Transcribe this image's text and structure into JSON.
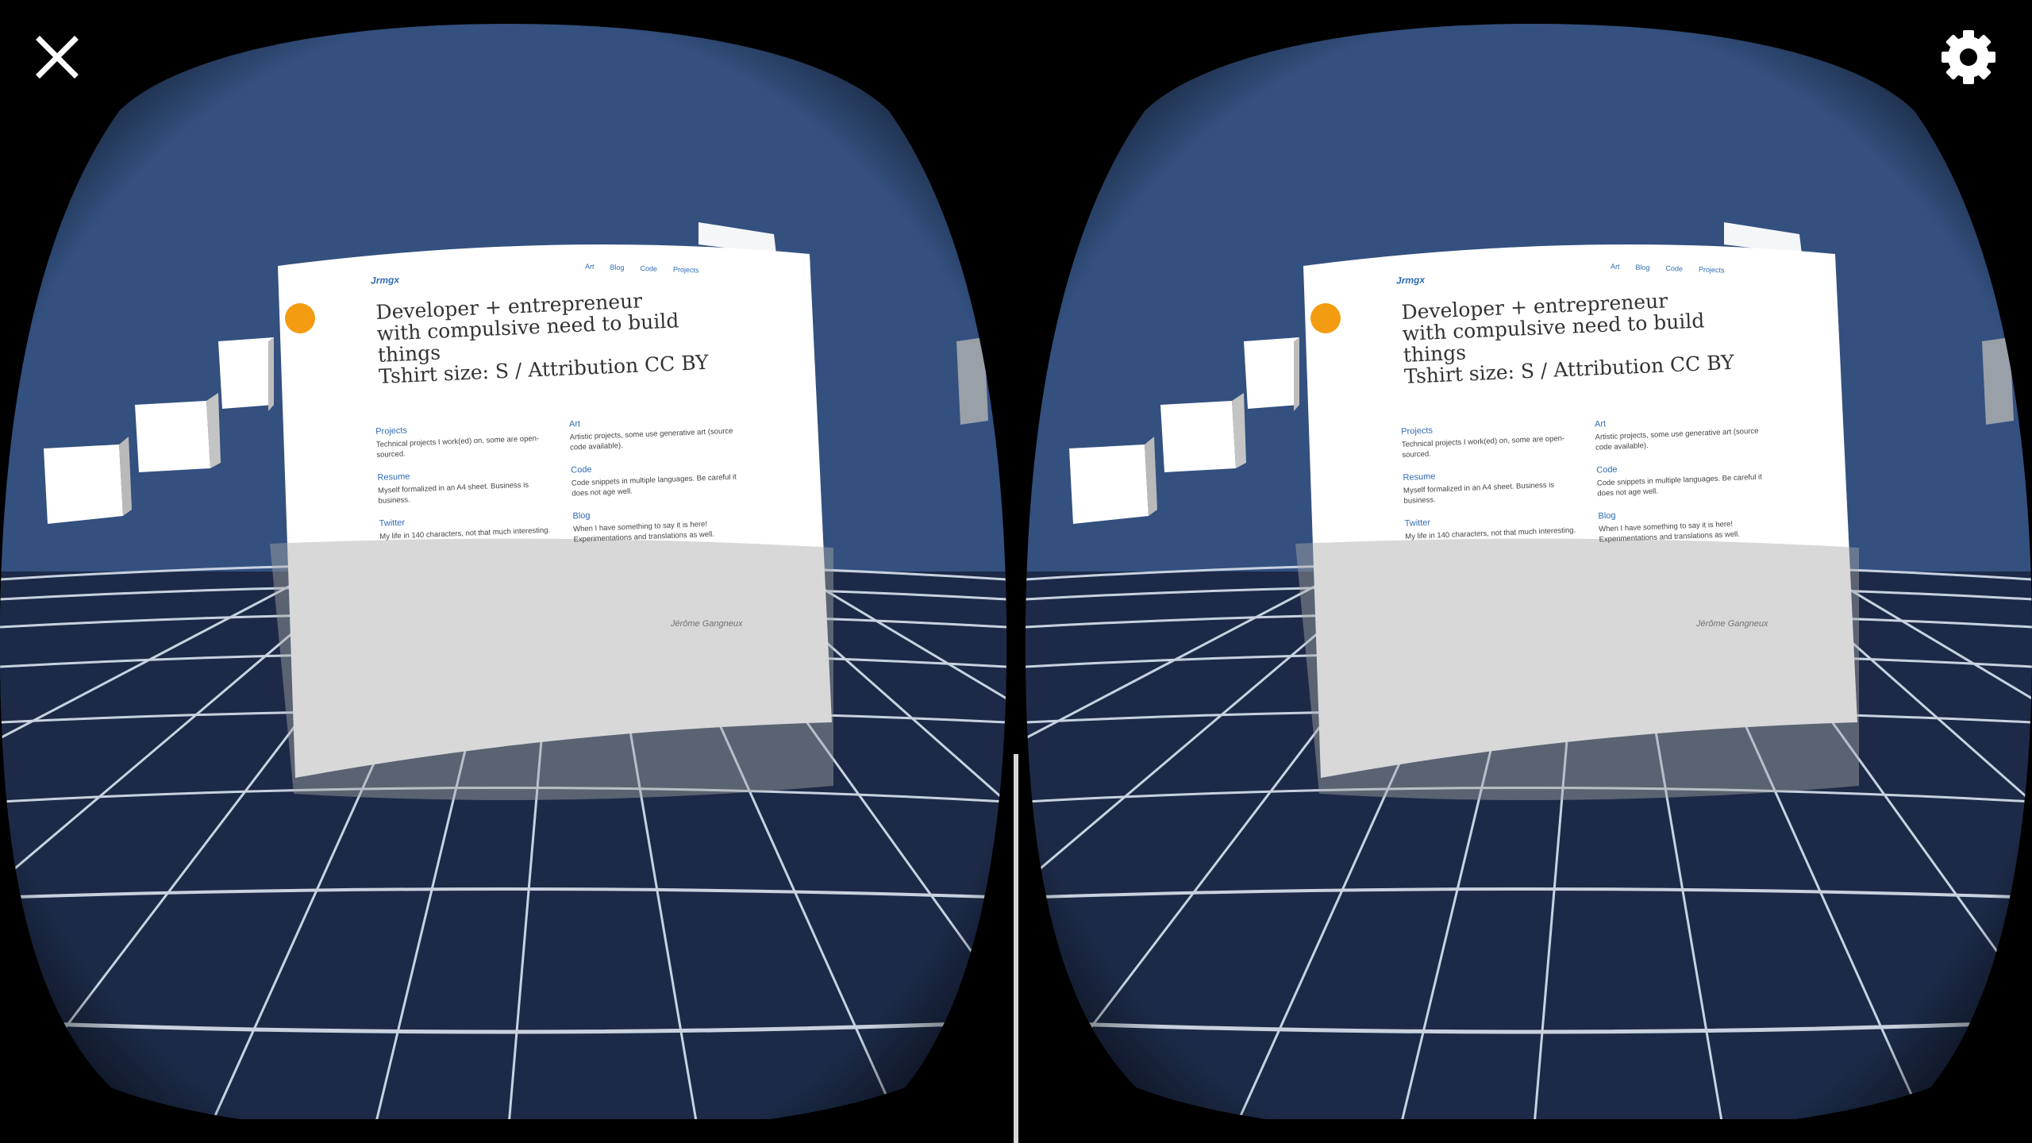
{
  "overlay": {
    "close_icon": "close-icon",
    "settings_icon": "gear-icon"
  },
  "scene": {
    "sky_color": "#33507f",
    "floor_color": "#1c2a47",
    "grid_color": "#c8d2e0",
    "panel_color": "#ffffff",
    "accent_color": "#f39c12",
    "link_color": "#2f6bb3"
  },
  "webpage": {
    "brand": "Jrmgx",
    "nav": [
      "Art",
      "Blog",
      "Code",
      "Projects"
    ],
    "headline": [
      "Developer + entrepreneur",
      "with compulsive need to build",
      "things",
      "Tshirt size: S / Attribution CC BY"
    ],
    "sections": [
      {
        "title": "Projects",
        "desc": "Technical projects I work(ed) on, some are open-sourced."
      },
      {
        "title": "Art",
        "desc": "Artistic projects, some use generative art (source code available)."
      },
      {
        "title": "Resume",
        "desc": "Myself formalized in an A4 sheet. Business is business."
      },
      {
        "title": "Code",
        "desc": "Code snippets in multiple languages. Be careful it does not age well."
      },
      {
        "title": "Twitter",
        "desc": "My life in 140 characters, not that much interesting."
      },
      {
        "title": "Blog",
        "desc": "When I have something to say it is here! Experimentations and translations as well."
      }
    ],
    "signature": "Jérôme Gangneux"
  }
}
